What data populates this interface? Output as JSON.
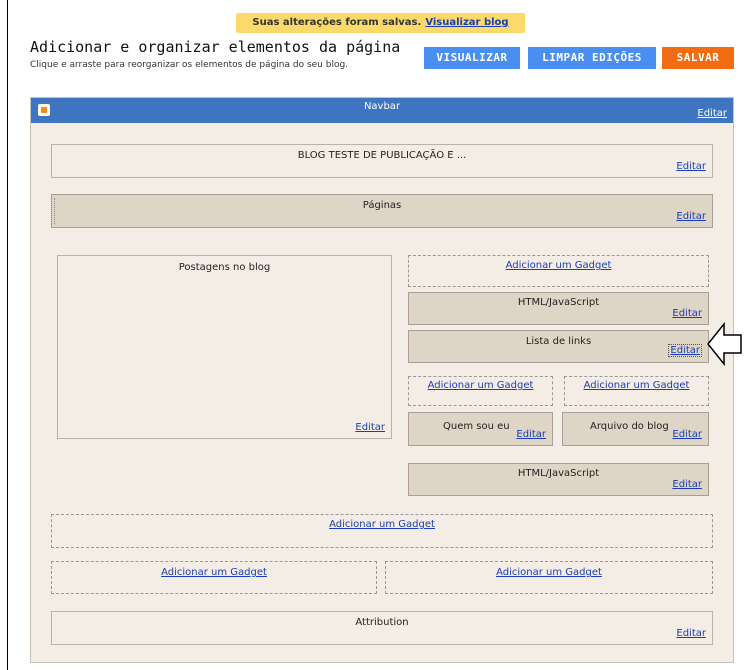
{
  "notice": {
    "text": "Suas alterações foram salvas.",
    "link": "Visualizar blog"
  },
  "header": {
    "title": "Adicionar e organizar elementos da página",
    "subtitle": "Clique e arraste para reorganizar os elementos de página do seu blog."
  },
  "buttons": {
    "preview": "VISUALIZAR",
    "clear": "LIMPAR EDIÇÕES",
    "save": "SALVAR"
  },
  "navbar": {
    "title": "Navbar",
    "edit": "Editar"
  },
  "widgets": {
    "header": {
      "title": "BLOG TESTE DE PUBLICAÇÃO E ...",
      "edit": "Editar"
    },
    "pages": {
      "title": "Páginas",
      "edit": "Editar"
    },
    "posts": {
      "title": "Postagens no blog",
      "edit": "Editar"
    },
    "sidebar_add": "Adicionar um Gadget",
    "html1": {
      "title": "HTML/JavaScript",
      "edit": "Editar"
    },
    "links": {
      "title": "Lista de links",
      "edit": "Editar"
    },
    "col_add_left": "Adicionar um Gadget",
    "col_add_right": "Adicionar um Gadget",
    "about": {
      "title": "Quem sou eu",
      "edit": "Editar"
    },
    "archive": {
      "title": "Arquivo do blog",
      "edit": "Editar"
    },
    "html2": {
      "title": "HTML/JavaScript",
      "edit": "Editar"
    },
    "footer_add": "Adicionar um Gadget",
    "footer_add_left": "Adicionar um Gadget",
    "footer_add_right": "Adicionar um Gadget",
    "attribution": {
      "title": "Attribution",
      "edit": "Editar"
    }
  },
  "colors": {
    "navbar": "#3f75c0",
    "button_blue": "#4a8ef2",
    "button_orange": "#f26c11",
    "notice": "#fbd96b",
    "link": "#1a3eb4"
  },
  "icons": {
    "navbar": "blogger-icon",
    "pointer": "arrow-left-icon"
  }
}
